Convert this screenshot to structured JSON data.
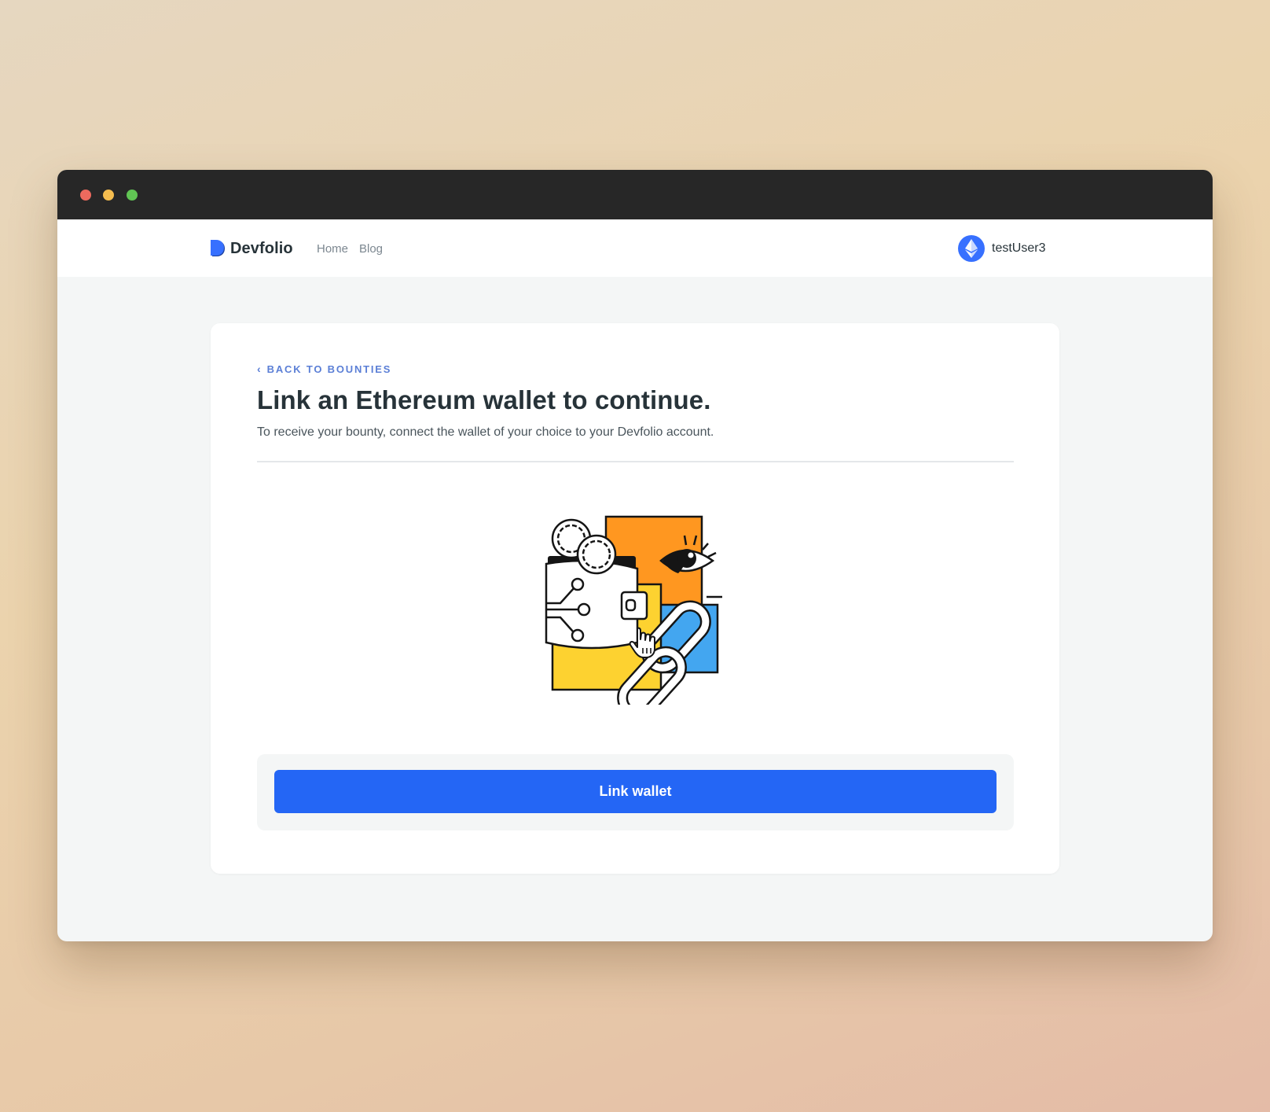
{
  "window": {
    "controls": [
      "close",
      "minimize",
      "maximize"
    ]
  },
  "navbar": {
    "brand": "Devfolio",
    "links": [
      {
        "label": "Home"
      },
      {
        "label": "Blog"
      }
    ],
    "user": {
      "name": "testUser3",
      "avatar_icon": "ethereum-icon"
    }
  },
  "card": {
    "back_link": "BACK TO BOUNTIES",
    "title": "Link an Ethereum wallet to continue.",
    "subtitle": "To receive your bounty, connect the wallet of your choice to your Devfolio account.",
    "illustration_icon": "wallet-link-illustration",
    "cta_label": "Link wallet"
  },
  "colors": {
    "accent": "#2466f5",
    "link": "#5b7fd6",
    "text_dark": "#273339",
    "background": "#f4f6f6"
  }
}
